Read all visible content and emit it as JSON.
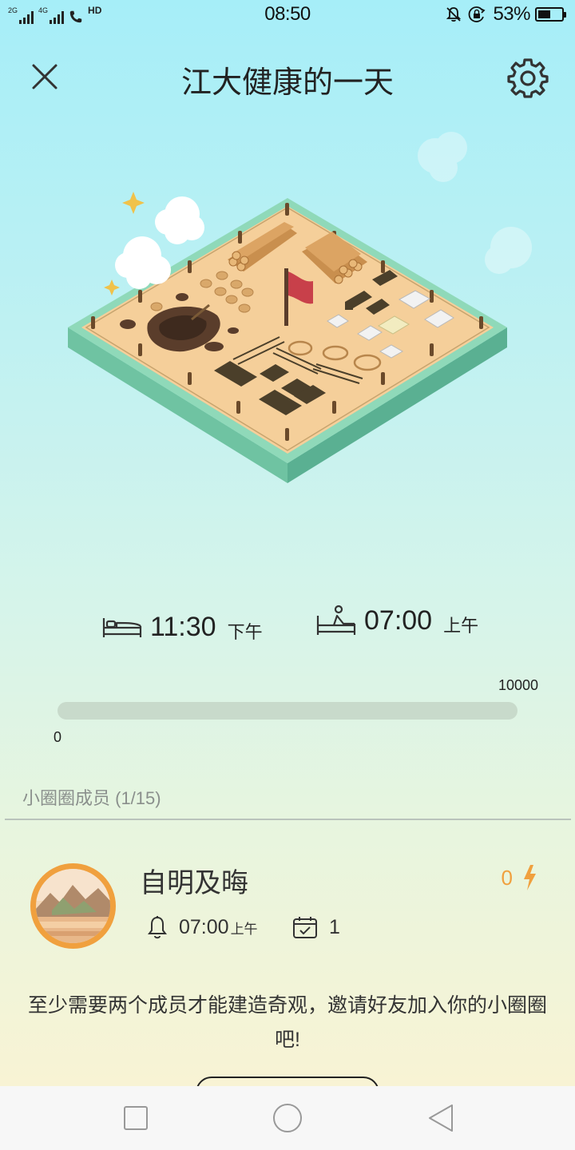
{
  "status_bar": {
    "signal1_label": "2G",
    "signal2_label": "4G",
    "hd_label": "HD",
    "time": "08:50",
    "battery_percent": "53%",
    "battery_level": 0.53
  },
  "header": {
    "title": "江大健康的一天",
    "close_icon": "close-icon",
    "settings_icon": "gear-icon"
  },
  "scene": {
    "icon": "construction-site-illustration"
  },
  "sleep": {
    "bed_time": "11:30",
    "bed_period": "下午",
    "wake_time": "07:00",
    "wake_period": "上午"
  },
  "progress": {
    "max_label": "10000",
    "min_label": "0",
    "value_fraction": 0
  },
  "members": {
    "section_label": "小圈圈成员 (1/15)",
    "items": [
      {
        "name": "自明及晦",
        "energy": "0",
        "alarm_time": "07:00",
        "alarm_period": "上午",
        "days": "1"
      }
    ]
  },
  "invite": {
    "message": "至少需要两个成员才能建造奇观，邀请好友加入你的小圈圈吧!"
  },
  "colors": {
    "accent_orange": "#f0a03e",
    "sky_top": "#a6eef8",
    "ground_bottom": "#f8f3d4"
  }
}
